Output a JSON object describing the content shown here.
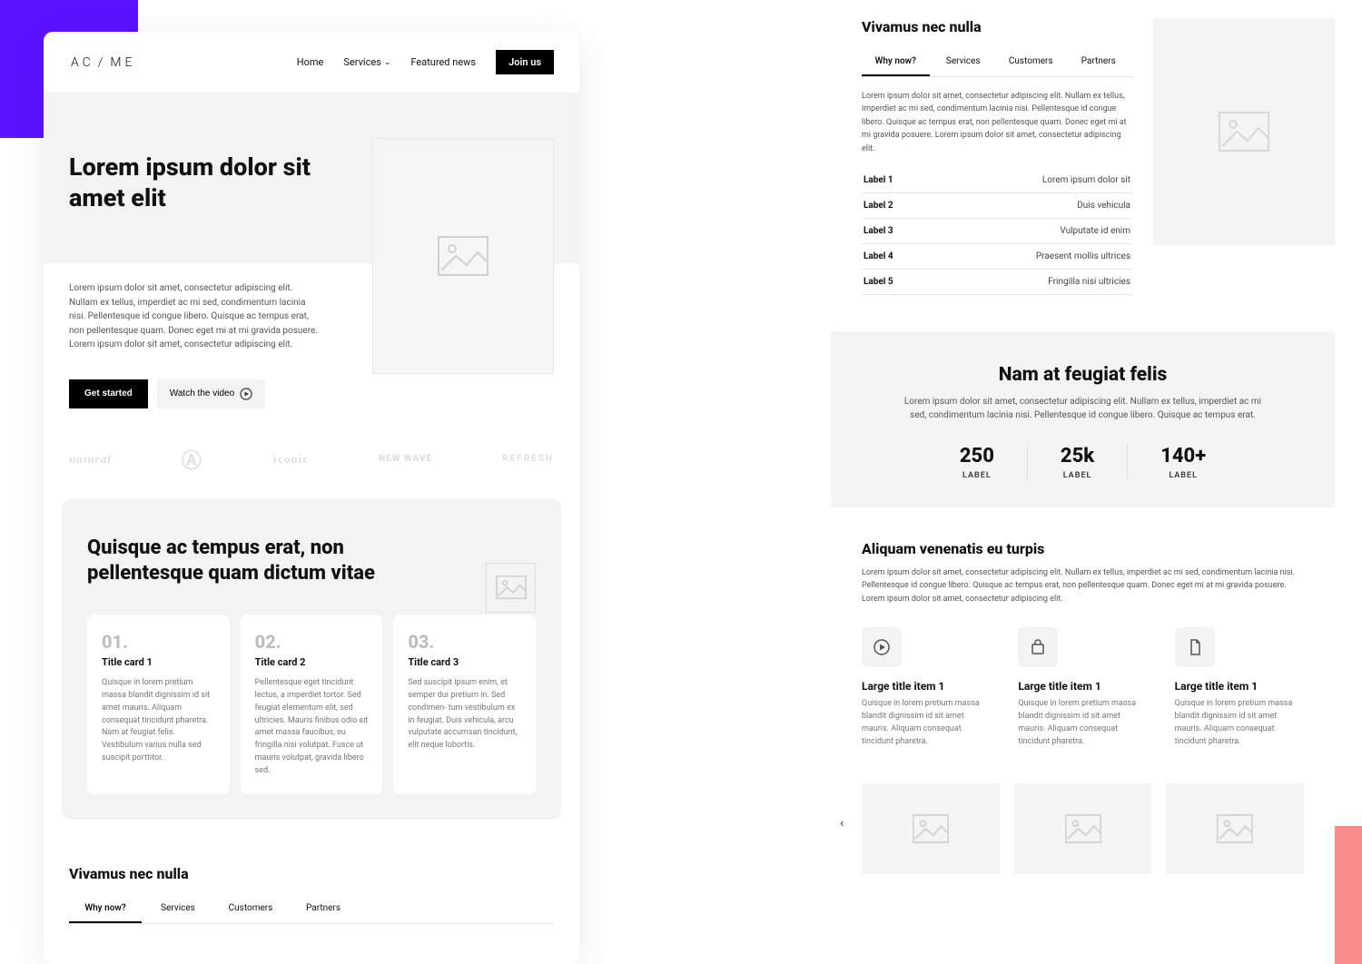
{
  "nav": {
    "logo_a": "AC",
    "logo_b": "ME",
    "home": "Home",
    "services": "Services",
    "featured": "Featured news",
    "join": "Join us"
  },
  "hero": {
    "title": "Lorem ipsum dolor sit amet elit",
    "body": "Lorem ipsum dolor sit amet, consectetur adipiscing elit. Nullam ex tellus, imperdiet ac mi sed, condimentum lacinia nisi. Pellentesque id congue libero. Quisque ac tempus erat, non pellentesque quam. Donec eget mi at mi gravida posuere. Lorem ipsum dolor sit amet, consectetur adipiscing elit.",
    "cta1": "Get started",
    "cta2": "Watch the video"
  },
  "logos": [
    "natural",
    "A",
    "Iconic",
    "NEW WAVE",
    "REFRESH"
  ],
  "feature": {
    "title": "Quisque ac tempus erat, non pellentesque quam dictum vitae",
    "cards": [
      {
        "num": "01.",
        "title": "Title card 1",
        "body": "Quisque in lorem pretium massa blandit dignissim id sit amet mauris. Aliquam consequat tincidunt pharetra. Nam at feugiat felis. Vestibulum varius nulla sed suscipit porttitor."
      },
      {
        "num": "02.",
        "title": "Title card 2",
        "body": "Pellentesque eget tincidunt lectus, a imperdiet tortor. Sed feugiat elementum elit, sed ultricies. Mauris finibus odio sit amet massa faucibus, eu fringilla nisi volutpat. Fusce ut mauris volutpat, gravida libero sed."
      },
      {
        "num": "03.",
        "title": "Title card 3",
        "body": "Sed suscipit ipsum enim, et semper dui pretium in. Sed condimen- tum vestibulum ex in feugiat. Duis vehicula, arcu vulputate accumsan tincidunt, elit neque lobortis."
      }
    ]
  },
  "tabs": {
    "heading": "Vivamus nec nulla",
    "items": [
      "Why now?",
      "Services",
      "Customers",
      "Partners"
    ],
    "active": 0
  },
  "sec1": {
    "text": "Lorem ipsum dolor sit amet, consectetur adipiscing elit. Nullam ex tellus, imperdiet ac mi sed, condimentum lacinia nisi. Pellentesque id congue libero. Quisque ac tempus erat, non pellentesque quam. Donec eget mi at mi gravida posuere. Lorem ipsum dolor sit amet, consectetur adipiscing elit.",
    "rows": [
      {
        "k": "Label 1",
        "v": "Lorem ipsum dolor sit"
      },
      {
        "k": "Label 2",
        "v": "Duis vehicula"
      },
      {
        "k": "Label 3",
        "v": "Vulputate id enim"
      },
      {
        "k": "Label 4",
        "v": "Praesent mollis ultrices"
      },
      {
        "k": "Label 5",
        "v": "Fringilla nisi ultricies"
      }
    ]
  },
  "sec2": {
    "title": "Nam at feugiat felis",
    "sub": "Lorem ipsum dolor sit amet, consectetur adipiscing elit. Nullam ex tellus, imperdiet ac mi sed, condimentum lacinia nisi. Pellentesque id congue libero. Quisque ac tempus erat.",
    "stats": [
      {
        "v": "250",
        "l": "LABEL"
      },
      {
        "v": "25k",
        "l": "LABEL"
      },
      {
        "v": "140+",
        "l": "LABEL"
      }
    ]
  },
  "sec3": {
    "title": "Aliquam venenatis eu turpis",
    "sub": "Lorem ipsum dolor sit amet, consectetur adipiscing elit. Nullam ex tellus, imperdiet ac mi sed, condimentum lacinia nisi. Pellentesque id congue libero. Quisque ac tempus erat, non pellentesque quam. Donec eget mi at mi gravida posuere. Lorem ipsum dolor sit amet, consectetur adipiscing elit.",
    "items": [
      {
        "title": "Large title item 1",
        "body": "Quisque in lorem pretium massa blandit dignissim id sit amet mauris. Aliquam consequat tincidunt pharetra."
      },
      {
        "title": "Large title item 1",
        "body": "Quisque in lorem pretium massa blandit dignissim id sit amet mauris. Aliquam consequat tincidunt pharetra."
      },
      {
        "title": "Large title item 1",
        "body": "Quisque in lorem pretium massa blandit dignissim id sit amet mauris. Aliquam consequat tincidunt pharetra."
      }
    ]
  }
}
